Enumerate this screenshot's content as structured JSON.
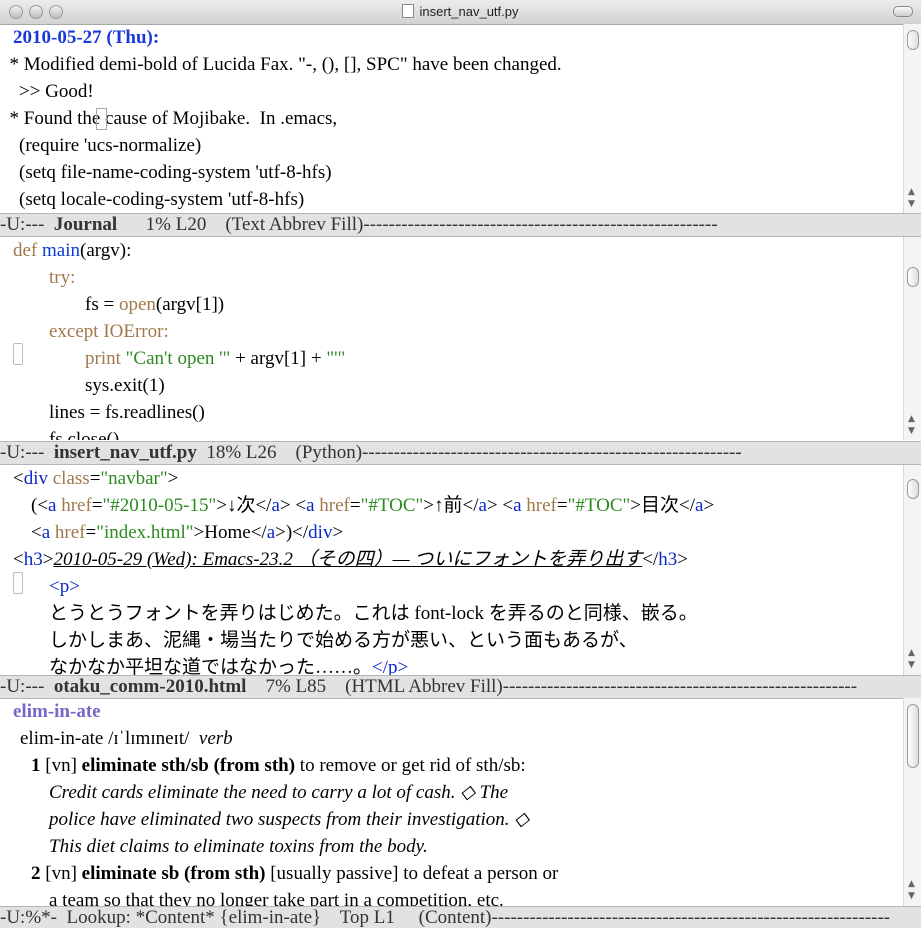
{
  "window": {
    "title": "insert_nav_utf.py"
  },
  "pane1": {
    "lines": [
      "  * Modified demi-bold of Lucida Fax. \"-, (), [], SPC\" have been changed.",
      "    >> Good!",
      "  * Found the cause of Mojibake.  In .emacs,",
      "    (require 'ucs-normalize)",
      "    (setq file-name-coding-system 'utf-8-hfs)",
      "    (setq locale-coding-system 'utf-8-hfs)"
    ],
    "date": "2010-05-27 (Thu):",
    "modeline": {
      "status": "-U:---  ",
      "buffer": "Journal",
      "info": "      1% L20    (Text Abbrev Fill)--------------------------------------------------------"
    }
  },
  "pane2": {
    "l1_def": "def",
    "l1_fn": "main",
    "l1_rest": "(argv):",
    "l2": "try:",
    "l3_a": "fs = ",
    "l3_open": "open",
    "l3_b": "(argv[1])",
    "l4": "except IOError:",
    "l5_print": "print",
    "l5_str1": "\"Can't open '\"",
    "l5_mid": " + argv[1] + ",
    "l5_str2": "\"'\"",
    "l6": "sys.exit(1)",
    "l7": "lines = fs.readlines()",
    "l8": "fs.close()",
    "modeline": {
      "status": "-U:---  ",
      "buffer": "insert_nav_utf.py",
      "info": "  18% L26    (Python)------------------------------------------------------------"
    }
  },
  "pane3": {
    "l1_open": "<",
    "l1_tag": "div",
    "l1_attr": "class",
    "l1_val": "\"navbar\"",
    "l1_close": ">",
    "l2_href1": "\"#2010-05-15\"",
    "l2_text1": "↓次",
    "l2_href2": "\"#TOC\"",
    "l2_text2": "↑前",
    "l2_href3": "\"#TOC\"",
    "l2_text3": "目次",
    "l3_href": "\"index.html\"",
    "l3_text": "Home",
    "l4_heading": "2010-05-29 (Wed): Emacs-23.2 （その四）— ついにフォントを弄り出す",
    "l5": "<p>",
    "l6": "とうとうフォントを弄りはじめた。これは font-lock を弄るのと同様、嵌る。",
    "l7": "しかしまあ、泥縄・場当たりで始める方が悪い、という面もあるが、",
    "l8_text": "なかなか平坦な道ではなかった……。",
    "l8_tag": "</p>",
    "modeline": {
      "status": "-U:---  ",
      "buffer": "otaku_comm-2010.html",
      "info": "    7% L85    (HTML Abbrev Fill)--------------------------------------------------------"
    }
  },
  "pane4": {
    "headword": "elim-in-ate",
    "pron_word": "elim-in-ate",
    "pron": "/ɪˈlɪmɪneɪt/",
    "pos": "verb",
    "s1_num": "1",
    "s1_code": "[vn]",
    "s1_phrase": "eliminate sth/sb (from sth)",
    "s1_def": "to remove or get rid of sth/sb:",
    "ex1": "Credit cards eliminate the need to carry a lot of cash. ◇ The",
    "ex2": "police have eliminated two suspects from their investigation. ◇",
    "ex3": "This diet claims to eliminate toxins from the body.",
    "s2_num": "2",
    "s2_code": "[vn]",
    "s2_phrase": "eliminate sb (from sth)",
    "s2_def": "[usually passive] to defeat a person or",
    "s2_cont": "a team so that they no longer take part in a competition, etc.",
    "modeline": {
      "status": "-U:%*-  ",
      "buffer": "Lookup: *Content* {elim-in-ate}",
      "info": "    Top L1     (Content)---------------------------------------------------------------"
    }
  }
}
